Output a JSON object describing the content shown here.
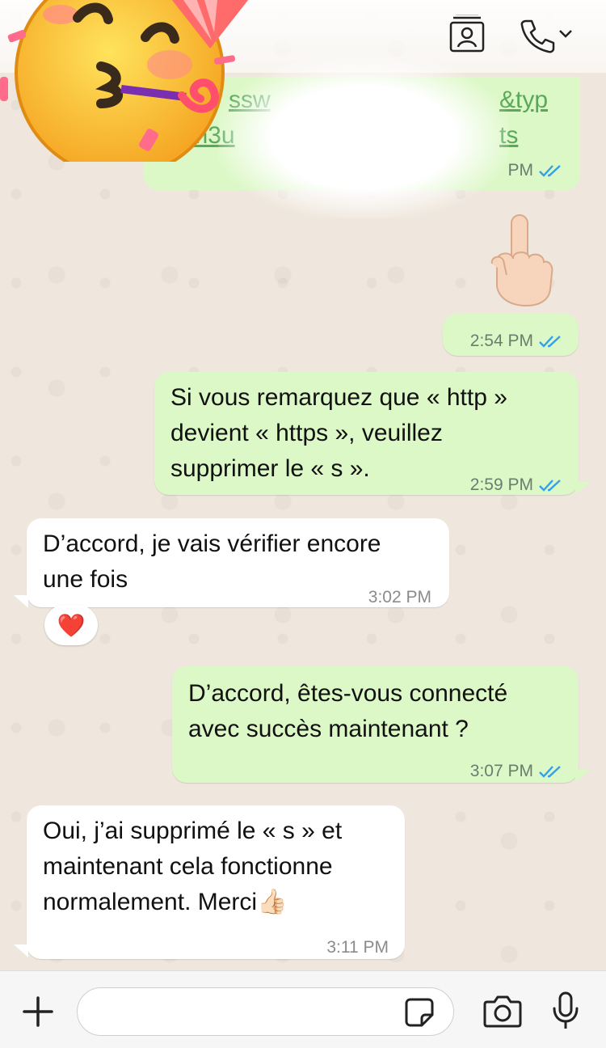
{
  "header": {
    "contact_card_icon": "contact-card-icon",
    "call_icon": "phone-icon",
    "call_menu_icon": "chevron-down-icon"
  },
  "stickers": {
    "party_emoji": "partying-face",
    "pointing_emoji": "index-pointing-up"
  },
  "messages": [
    {
      "direction": "out",
      "partial": true,
      "link_fragments": [
        "ssw",
        "&typ",
        "e=m3u",
        "ts"
      ],
      "time": "PM",
      "status": "read"
    },
    {
      "direction": "out",
      "type": "sticker",
      "time": "2:54 PM",
      "status": "read"
    },
    {
      "direction": "out",
      "lines": [
        "Si vous remarquez que « http »",
        "devient « https », veuillez",
        "supprimer le « s »."
      ],
      "time": "2:59 PM",
      "status": "read"
    },
    {
      "direction": "in",
      "lines": [
        "D’accord, je vais vérifier encore",
        "une fois"
      ],
      "time": "3:02 PM",
      "reaction": "❤️"
    },
    {
      "direction": "out",
      "lines": [
        "D’accord, êtes-vous connecté",
        "avec succès maintenant ?"
      ],
      "time": "3:07 PM",
      "status": "read"
    },
    {
      "direction": "in",
      "lines": [
        "Oui, j’ai supprimé le « s » et",
        "maintenant cela fonctionne",
        "normalement. Merci"
      ],
      "trailing_emoji": "👍🏻",
      "time": "3:11 PM"
    }
  ],
  "composer": {
    "add_icon": "plus-icon",
    "sticker_icon": "sticker-icon",
    "camera_icon": "camera-icon",
    "mic_icon": "microphone-icon",
    "placeholder": ""
  },
  "colors": {
    "outgoing_bubble": "#dcf8c6",
    "incoming_bubble": "#ffffff",
    "read_ticks": "#34a0e8",
    "wallpaper": "#efe7dd"
  }
}
